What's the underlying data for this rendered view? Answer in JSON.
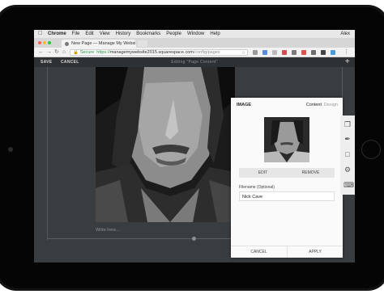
{
  "menubar": {
    "apple_icon": "apple-icon",
    "items": [
      "Chrome",
      "File",
      "Edit",
      "View",
      "History",
      "Bookmarks",
      "People",
      "Window",
      "Help"
    ],
    "user": "Alex"
  },
  "browser": {
    "tab_title": "New Page — Manage My Websi",
    "address": {
      "secure_label": "Secure",
      "scheme": "https://",
      "host": "managemywebsite2015.squarespace.com",
      "path": "/config/pages"
    }
  },
  "editor": {
    "save_label": "SAVE",
    "cancel_label": "CANCEL",
    "editing_label": "Editing \"Page Content\"",
    "add_label": "+",
    "placeholder": "Write here..."
  },
  "image_panel": {
    "title": "IMAGE",
    "tabs": [
      "Content",
      "Design"
    ],
    "edit_label": "EDIT",
    "remove_label": "REMOVE",
    "filename_label": "Filename (Optional)",
    "filename_value": "Nick Cave",
    "cancel_label": "CANCEL",
    "apply_label": "APPLY"
  },
  "sidebar_icons": [
    "pages-icon",
    "style-icon",
    "folder-icon",
    "settings-icon",
    "keyboard-icon"
  ],
  "colors": {
    "editor_bg": "#3a3d40",
    "panel_bg": "#fafafa",
    "secure_green": "#1e8e3e"
  }
}
